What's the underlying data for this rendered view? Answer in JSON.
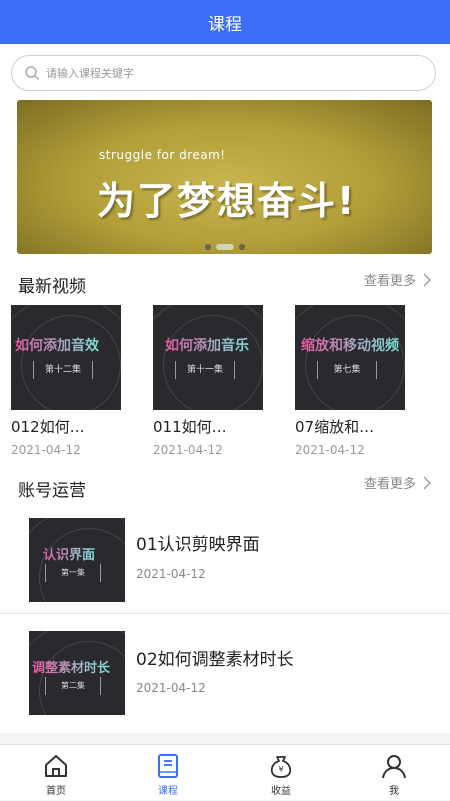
{
  "header": {
    "title": "课程"
  },
  "search": {
    "placeholder": "请输入课程关键字"
  },
  "banner": {
    "subtitle": "struggle for dream!",
    "title": "为了梦想奋斗!"
  },
  "latest": {
    "title": "最新视频",
    "more": "查看更多",
    "items": [
      {
        "thumb_title": "如何添加音效",
        "thumb_episode": "第十二集",
        "name": "012如何…",
        "date": "2021-04-12"
      },
      {
        "thumb_title": "如何添加音乐",
        "thumb_episode": "第十一集",
        "name": "011如何…",
        "date": "2021-04-12"
      },
      {
        "thumb_title": "缩放和移动视频",
        "thumb_episode": "第七集",
        "name": "07缩放和…",
        "date": "2021-04-12"
      }
    ]
  },
  "account": {
    "title": "账号运营",
    "more": "查看更多",
    "items": [
      {
        "thumb_title": "认识界面",
        "thumb_episode": "第一集",
        "name": "01认识剪映界面",
        "date": "2021-04-12"
      },
      {
        "thumb_title": "调整素材时长",
        "thumb_episode": "第二集",
        "name": "02如何调整素材时长",
        "date": "2021-04-12"
      }
    ]
  },
  "tabbar": {
    "items": [
      {
        "label": "首页",
        "icon": "home-icon"
      },
      {
        "label": "课程",
        "icon": "book-icon"
      },
      {
        "label": "收益",
        "icon": "money-bag-icon"
      },
      {
        "label": "我",
        "icon": "user-icon"
      }
    ]
  },
  "colors": {
    "accent": "#3d6ef5",
    "text": "#222222",
    "muted": "#999999"
  }
}
